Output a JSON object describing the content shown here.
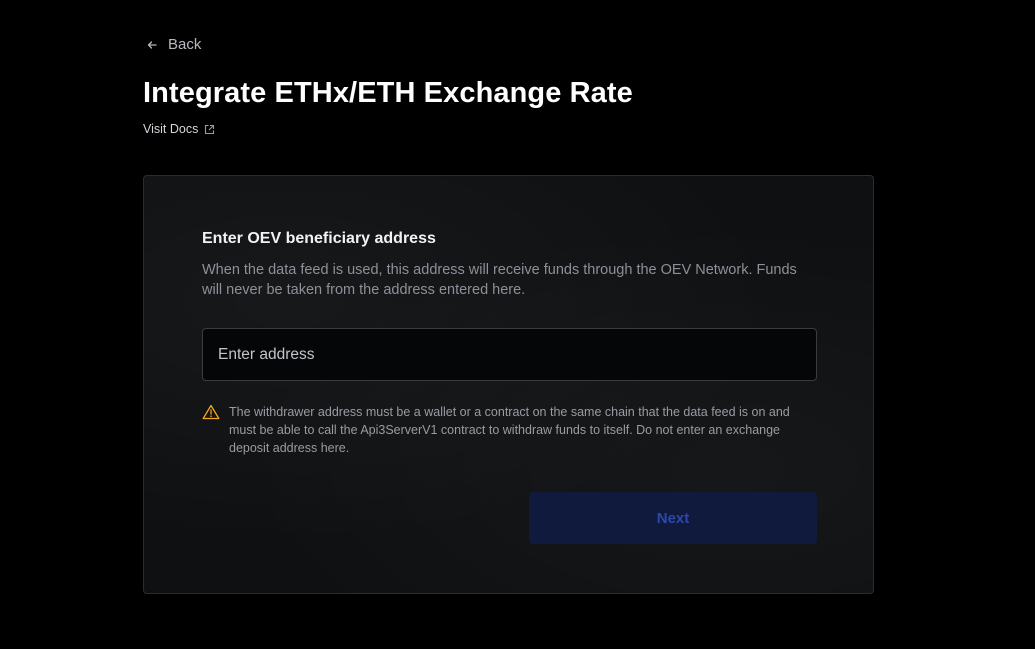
{
  "nav": {
    "back_label": "Back",
    "back_icon": "arrow-left-icon"
  },
  "header": {
    "title": "Integrate ETHx/ETH Exchange Rate",
    "docs_label": "Visit Docs",
    "docs_icon": "external-link-icon"
  },
  "form": {
    "title": "Enter OEV beneficiary address",
    "description": "When the data feed is used, this address will receive funds through the OEV Network. Funds will never be taken from the address entered here.",
    "address_input": {
      "value": "",
      "placeholder": "Enter address"
    },
    "warning": {
      "icon": "warning-triangle-icon",
      "text": "The withdrawer address must be a wallet or a contract on the same chain that the data feed is on and must be able to call the Api3ServerV1 contract to withdraw funds to itself. Do not enter an exchange deposit address here."
    },
    "next_label": "Next"
  },
  "colors": {
    "background": "#000000",
    "card_background": "#0e1012",
    "warning_accent": "#f5a623",
    "button_disabled_bg": "#101a3d",
    "button_disabled_text": "#2f47a8"
  }
}
